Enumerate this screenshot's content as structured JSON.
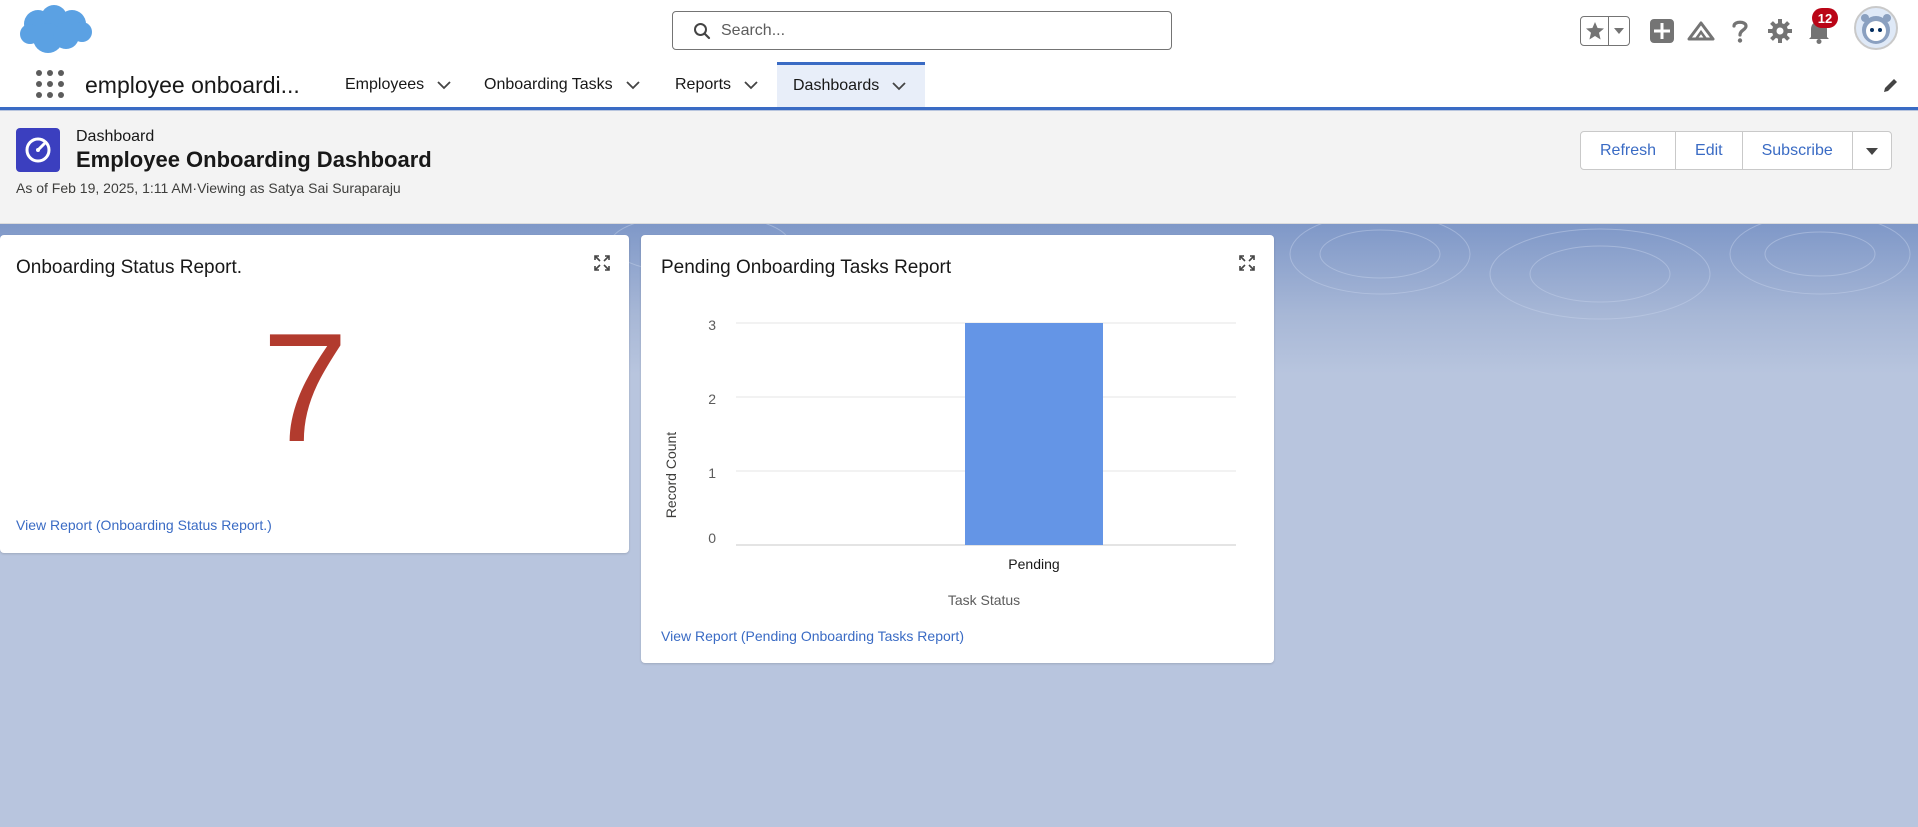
{
  "search": {
    "placeholder": "Search..."
  },
  "notifications": {
    "count": "12"
  },
  "nav": {
    "app_name": "employee onboardi...",
    "tabs": [
      {
        "label": "Employees"
      },
      {
        "label": "Onboarding Tasks"
      },
      {
        "label": "Reports"
      },
      {
        "label": "Dashboards"
      }
    ]
  },
  "page": {
    "crumb": "Dashboard",
    "title": "Employee Onboarding Dashboard",
    "asof": "As of Feb 19, 2025, 1:11 AM·Viewing as Satya Sai Suraparaju",
    "buttons": {
      "refresh": "Refresh",
      "edit": "Edit",
      "subscribe": "Subscribe"
    }
  },
  "widgets": {
    "status": {
      "title": "Onboarding Status Report.",
      "value": "7",
      "link": "View Report (Onboarding Status Report.)"
    },
    "pending": {
      "title": "Pending Onboarding Tasks Report",
      "link": "View Report (Pending Onboarding Tasks Report)"
    }
  },
  "colors": {
    "brand": "#3a6bc4",
    "metric": "#b23b2e",
    "bar": "#6495e6",
    "badge": "#ba0517"
  },
  "chart_data": {
    "type": "bar",
    "title": "Pending Onboarding Tasks Report",
    "categories": [
      "Pending"
    ],
    "values": [
      3
    ],
    "xlabel": "Task Status",
    "ylabel": "Record Count",
    "ylim": [
      0,
      3
    ],
    "yticks": [
      "0",
      "1",
      "2",
      "3"
    ],
    "grid": true
  }
}
